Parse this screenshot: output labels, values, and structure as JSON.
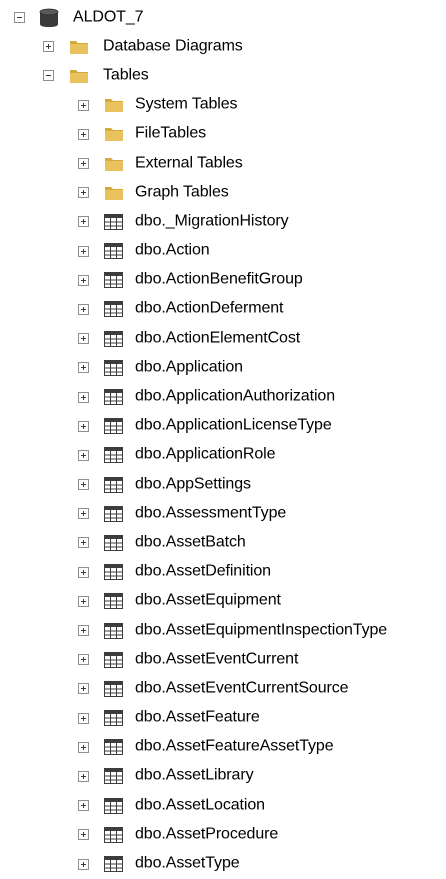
{
  "tree": {
    "database": {
      "label": "ALDOT_7",
      "icon": "database-icon",
      "expanded": true
    },
    "folders_level1": [
      {
        "label": "Database Diagrams",
        "icon": "folder-icon",
        "expanded": false
      },
      {
        "label": "Tables",
        "icon": "folder-icon",
        "expanded": true
      }
    ],
    "table_folders": [
      {
        "label": "System Tables",
        "icon": "folder-icon",
        "expanded": false
      },
      {
        "label": "FileTables",
        "icon": "folder-icon",
        "expanded": false
      },
      {
        "label": "External Tables",
        "icon": "folder-icon",
        "expanded": false
      },
      {
        "label": "Graph Tables",
        "icon": "folder-icon",
        "expanded": false
      }
    ],
    "tables": [
      "dbo._MigrationHistory",
      "dbo.Action",
      "dbo.ActionBenefitGroup",
      "dbo.ActionDeferment",
      "dbo.ActionElementCost",
      "dbo.Application",
      "dbo.ApplicationAuthorization",
      "dbo.ApplicationLicenseType",
      "dbo.ApplicationRole",
      "dbo.AppSettings",
      "dbo.AssessmentType",
      "dbo.AssetBatch",
      "dbo.AssetDefinition",
      "dbo.AssetEquipment",
      "dbo.AssetEquipmentInspectionType",
      "dbo.AssetEventCurrent",
      "dbo.AssetEventCurrentSource",
      "dbo.AssetFeature",
      "dbo.AssetFeatureAssetType",
      "dbo.AssetLibrary",
      "dbo.AssetLocation",
      "dbo.AssetProcedure",
      "dbo.AssetType"
    ],
    "table_icon": "table-grid-icon",
    "colors": {
      "folder": "#e8c25e",
      "folder_dark": "#d6a93c",
      "database": "#3a3a3a",
      "table_grid": "#3d3d3d",
      "toggle_border": "#8e8f8f"
    }
  }
}
